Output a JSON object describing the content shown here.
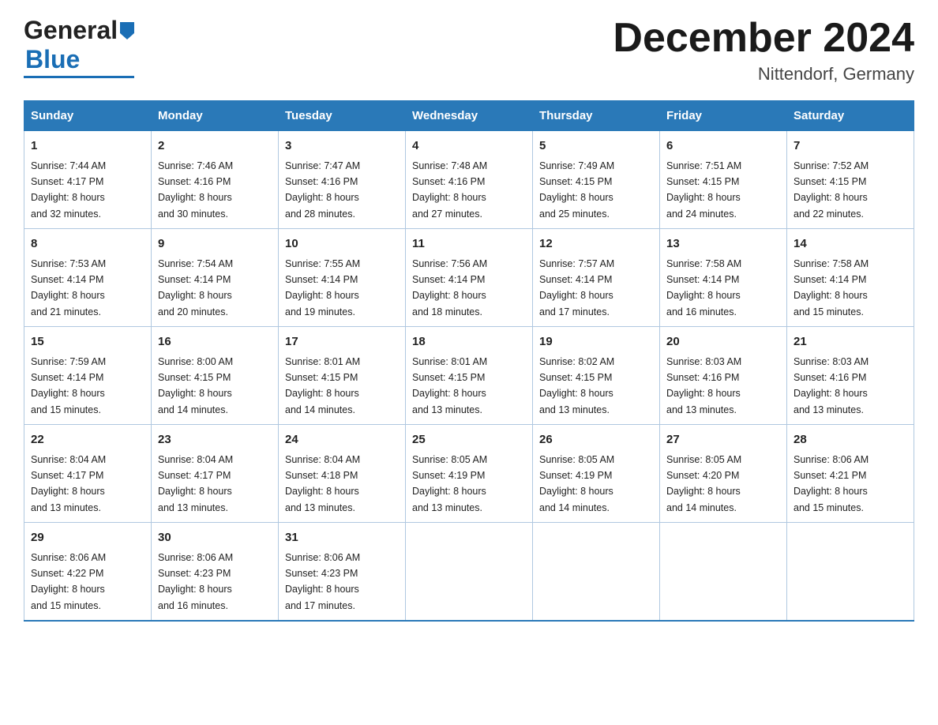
{
  "header": {
    "month_year": "December 2024",
    "location": "Nittendorf, Germany",
    "logo_line1": "General",
    "logo_line2": "Blue"
  },
  "days_of_week": [
    "Sunday",
    "Monday",
    "Tuesday",
    "Wednesday",
    "Thursday",
    "Friday",
    "Saturday"
  ],
  "weeks": [
    [
      {
        "day": "1",
        "sunrise": "7:44 AM",
        "sunset": "4:17 PM",
        "daylight": "8 hours and 32 minutes."
      },
      {
        "day": "2",
        "sunrise": "7:46 AM",
        "sunset": "4:16 PM",
        "daylight": "8 hours and 30 minutes."
      },
      {
        "day": "3",
        "sunrise": "7:47 AM",
        "sunset": "4:16 PM",
        "daylight": "8 hours and 28 minutes."
      },
      {
        "day": "4",
        "sunrise": "7:48 AM",
        "sunset": "4:16 PM",
        "daylight": "8 hours and 27 minutes."
      },
      {
        "day": "5",
        "sunrise": "7:49 AM",
        "sunset": "4:15 PM",
        "daylight": "8 hours and 25 minutes."
      },
      {
        "day": "6",
        "sunrise": "7:51 AM",
        "sunset": "4:15 PM",
        "daylight": "8 hours and 24 minutes."
      },
      {
        "day": "7",
        "sunrise": "7:52 AM",
        "sunset": "4:15 PM",
        "daylight": "8 hours and 22 minutes."
      }
    ],
    [
      {
        "day": "8",
        "sunrise": "7:53 AM",
        "sunset": "4:14 PM",
        "daylight": "8 hours and 21 minutes."
      },
      {
        "day": "9",
        "sunrise": "7:54 AM",
        "sunset": "4:14 PM",
        "daylight": "8 hours and 20 minutes."
      },
      {
        "day": "10",
        "sunrise": "7:55 AM",
        "sunset": "4:14 PM",
        "daylight": "8 hours and 19 minutes."
      },
      {
        "day": "11",
        "sunrise": "7:56 AM",
        "sunset": "4:14 PM",
        "daylight": "8 hours and 18 minutes."
      },
      {
        "day": "12",
        "sunrise": "7:57 AM",
        "sunset": "4:14 PM",
        "daylight": "8 hours and 17 minutes."
      },
      {
        "day": "13",
        "sunrise": "7:58 AM",
        "sunset": "4:14 PM",
        "daylight": "8 hours and 16 minutes."
      },
      {
        "day": "14",
        "sunrise": "7:58 AM",
        "sunset": "4:14 PM",
        "daylight": "8 hours and 15 minutes."
      }
    ],
    [
      {
        "day": "15",
        "sunrise": "7:59 AM",
        "sunset": "4:14 PM",
        "daylight": "8 hours and 15 minutes."
      },
      {
        "day": "16",
        "sunrise": "8:00 AM",
        "sunset": "4:15 PM",
        "daylight": "8 hours and 14 minutes."
      },
      {
        "day": "17",
        "sunrise": "8:01 AM",
        "sunset": "4:15 PM",
        "daylight": "8 hours and 14 minutes."
      },
      {
        "day": "18",
        "sunrise": "8:01 AM",
        "sunset": "4:15 PM",
        "daylight": "8 hours and 13 minutes."
      },
      {
        "day": "19",
        "sunrise": "8:02 AM",
        "sunset": "4:15 PM",
        "daylight": "8 hours and 13 minutes."
      },
      {
        "day": "20",
        "sunrise": "8:03 AM",
        "sunset": "4:16 PM",
        "daylight": "8 hours and 13 minutes."
      },
      {
        "day": "21",
        "sunrise": "8:03 AM",
        "sunset": "4:16 PM",
        "daylight": "8 hours and 13 minutes."
      }
    ],
    [
      {
        "day": "22",
        "sunrise": "8:04 AM",
        "sunset": "4:17 PM",
        "daylight": "8 hours and 13 minutes."
      },
      {
        "day": "23",
        "sunrise": "8:04 AM",
        "sunset": "4:17 PM",
        "daylight": "8 hours and 13 minutes."
      },
      {
        "day": "24",
        "sunrise": "8:04 AM",
        "sunset": "4:18 PM",
        "daylight": "8 hours and 13 minutes."
      },
      {
        "day": "25",
        "sunrise": "8:05 AM",
        "sunset": "4:19 PM",
        "daylight": "8 hours and 13 minutes."
      },
      {
        "day": "26",
        "sunrise": "8:05 AM",
        "sunset": "4:19 PM",
        "daylight": "8 hours and 14 minutes."
      },
      {
        "day": "27",
        "sunrise": "8:05 AM",
        "sunset": "4:20 PM",
        "daylight": "8 hours and 14 minutes."
      },
      {
        "day": "28",
        "sunrise": "8:06 AM",
        "sunset": "4:21 PM",
        "daylight": "8 hours and 15 minutes."
      }
    ],
    [
      {
        "day": "29",
        "sunrise": "8:06 AM",
        "sunset": "4:22 PM",
        "daylight": "8 hours and 15 minutes."
      },
      {
        "day": "30",
        "sunrise": "8:06 AM",
        "sunset": "4:23 PM",
        "daylight": "8 hours and 16 minutes."
      },
      {
        "day": "31",
        "sunrise": "8:06 AM",
        "sunset": "4:23 PM",
        "daylight": "8 hours and 17 minutes."
      },
      {
        "day": "",
        "sunrise": "",
        "sunset": "",
        "daylight": ""
      },
      {
        "day": "",
        "sunrise": "",
        "sunset": "",
        "daylight": ""
      },
      {
        "day": "",
        "sunrise": "",
        "sunset": "",
        "daylight": ""
      },
      {
        "day": "",
        "sunrise": "",
        "sunset": "",
        "daylight": ""
      }
    ]
  ],
  "label_sunrise": "Sunrise:",
  "label_sunset": "Sunset:",
  "label_daylight": "Daylight:"
}
